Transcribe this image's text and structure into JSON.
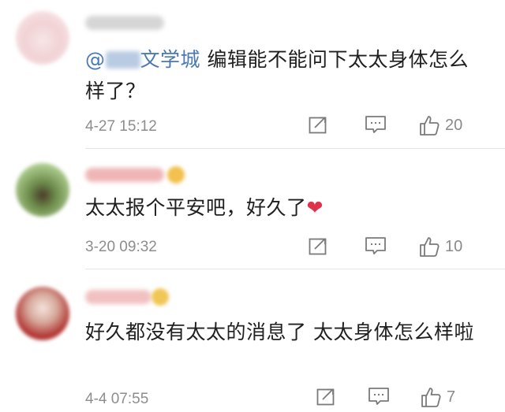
{
  "comments": [
    {
      "mention_prefix": "@",
      "mention_suffix": "文学城",
      "text": " 编辑能不能问下太太身体怎么样了？",
      "time": "4-27 15:12",
      "likes": "20",
      "avatar_color": "#f3d4d6"
    },
    {
      "text": "太太报个平安吧，好久了",
      "heart": "❤",
      "time": "3-20 09:32",
      "likes": "10",
      "avatar_color": "#7fa85d"
    },
    {
      "text": "好久都没有太太的消息了 太太身体怎么样啦",
      "time": "4-4 07:55",
      "likes": "7",
      "avatar_color": "#b73a3a"
    }
  ],
  "icons": {
    "repost": "repost-icon",
    "comment": "comment-icon",
    "like": "thumbs-up-icon"
  },
  "colors": {
    "mention": "#4a78b5",
    "heart": "#e0314b",
    "meta": "#8d8d8d"
  }
}
